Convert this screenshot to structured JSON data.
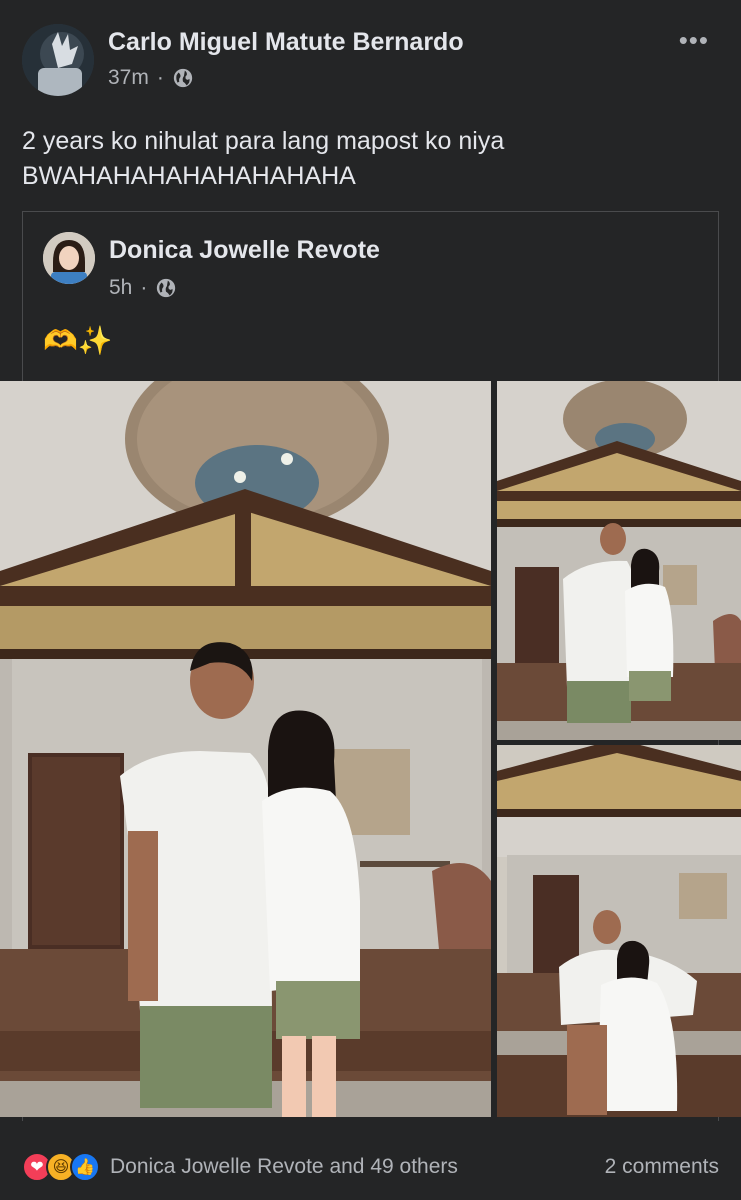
{
  "post": {
    "author": "Carlo Miguel Matute Bernardo",
    "time": "37m",
    "separator": "·",
    "privacy_icon": "globe-icon",
    "more_icon": "more-options-icon",
    "more_label": "•••",
    "text_line1": "2 years ko nihulat para lang mapost ko niya",
    "text_line2": "BWAHAHAHAHAHAHAHAHA"
  },
  "shared": {
    "author": "Donica Jowelle Revote",
    "time": "5h",
    "separator": "·",
    "privacy_icon": "globe-icon",
    "text": "🫶✨"
  },
  "photos": [
    {
      "name": "couple standing under lamp"
    },
    {
      "name": "couple standing wide shot"
    },
    {
      "name": "couple sitting on steps"
    }
  ],
  "footer": {
    "reactions": [
      "love",
      "haha",
      "like"
    ],
    "reaction_glyphs": {
      "love": "❤",
      "haha": "😆",
      "like": "👍"
    },
    "summary": "Donica Jowelle Revote and 49 others",
    "comments": "2 comments"
  },
  "colors": {
    "background": "#242526",
    "text_primary": "#e4e6eb",
    "text_secondary": "#b0b3b8",
    "love": "#f33e58",
    "haha": "#f7b125",
    "like": "#1877f2"
  }
}
